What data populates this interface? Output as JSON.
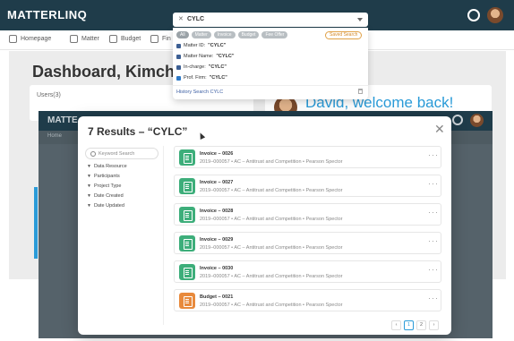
{
  "app": {
    "brand": "MATTERLINQ"
  },
  "nav": {
    "items": [
      {
        "label": "Homepage",
        "icon": "home-icon"
      },
      {
        "label": "Matter",
        "icon": "briefcase-icon"
      },
      {
        "label": "Budget",
        "icon": "budget-icon"
      },
      {
        "label": "Fin",
        "icon": "finance-icon"
      }
    ]
  },
  "dashboard": {
    "title": "Dashboard, Kimchi App",
    "users_label": "Users(3)",
    "welcome": "David, welcome back!"
  },
  "inner": {
    "brand": "MATTE",
    "home": "Home"
  },
  "search": {
    "value": "CYLC",
    "chips": [
      "All",
      "Matter",
      "Invoice",
      "Budget",
      "Fee Offer"
    ],
    "saved_label": "Saved Search",
    "suggestions": [
      {
        "prefix": "Matter ID: ",
        "value": "\"CYLC\"",
        "icon": "hash-icon"
      },
      {
        "prefix": "Matter Name: ",
        "value": "\"CYLC\"",
        "icon": "bookmark-icon"
      },
      {
        "prefix": "In-charge: ",
        "value": "\"CYLC\"",
        "icon": "person-icon"
      },
      {
        "prefix": "Prof. Firm: ",
        "value": "\"CYLC\"",
        "icon": "building-icon"
      }
    ],
    "history": "History Search CYLC"
  },
  "modal": {
    "title": "7 Results – “CYLC”",
    "keyword_placeholder": "Keyword Search",
    "filters": [
      "Data Resource",
      "Participants",
      "Project Type",
      "Date Created",
      "Date Updated"
    ],
    "results": [
      {
        "title": "Invoice – 0026",
        "subtitle": "2019–000057 • AC – Antitrust and Competition • Pearson Spector",
        "color": "#3dae7a"
      },
      {
        "title": "Invoice – 0027",
        "subtitle": "2019–000057 • AC – Antitrust and Competition • Pearson Spector",
        "color": "#3dae7a"
      },
      {
        "title": "Invoice – 0028",
        "subtitle": "2019–000057 • AC – Antitrust and Competition • Pearson Spector",
        "color": "#3dae7a"
      },
      {
        "title": "Invoice – 0029",
        "subtitle": "2019–000057 • AC – Antitrust and Competition • Pearson Spector",
        "color": "#3dae7a"
      },
      {
        "title": "Invoice – 0030",
        "subtitle": "2019–000057 • AC – Antitrust and Competition • Pearson Spector",
        "color": "#3dae7a"
      },
      {
        "title": "Budget – 0021",
        "subtitle": "2019–000057 • AC – Antitrust and Competition • Pearson Spector",
        "color": "#e88a3c"
      }
    ],
    "pager": {
      "prev": "‹",
      "pages": [
        "1",
        "2"
      ],
      "next": "›"
    }
  },
  "colors": {
    "topbar": "#1f3c4a",
    "accent_blue": "#2a9bd8",
    "saved_orange": "#d48a2a"
  }
}
